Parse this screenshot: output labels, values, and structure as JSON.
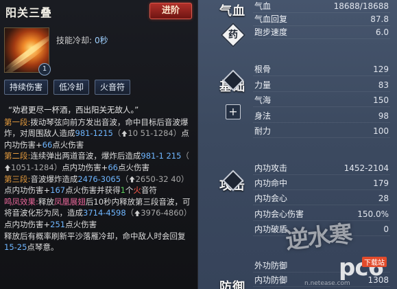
{
  "skill": {
    "title": "阳关三叠",
    "advance_label": "进阶",
    "level": "1",
    "cooldown_label": "技能冷却:",
    "cooldown_value": "0秒",
    "tags": [
      "持续伤害",
      "低冷却",
      "火音符"
    ],
    "quote": "“劝君更尽一杯酒，西出阳关无故人。”",
    "stage1": {
      "head": "第一段:",
      "text1": "拨动琴弦向前方发出音波，命中目标后音波爆炸，对周围敌人造成",
      "dmg": "981-1215",
      "up": "10 51-1284",
      "mid": "点内功伤害+",
      "fire": "66",
      "tail": "点火伤害"
    },
    "stage2": {
      "head": "第二段:",
      "text1": "连续弹出两道音波，爆炸后造成",
      "dmg": "981-1 215",
      "up": "1051-1284",
      "mid": "点内功伤害+",
      "fire": "66",
      "tail": "点火伤害"
    },
    "stage3": {
      "head": "第三段:",
      "text1": "音波爆炸造成",
      "dmg": "2476-3065",
      "up": "2650-32 40",
      "mid": "点内功伤害+",
      "fire": "167",
      "tail": "点火伤害并获得",
      "count": "1",
      "note": "个",
      "fire_note": "火",
      "tail2": "音符"
    },
    "effect": {
      "head": "鸣凤效果:",
      "text1": "释放",
      "skill_name": "凤凰展翅",
      "text2": "后10秒内释放第三段音波，可将音波化形为凤，造成",
      "dmg": "3714-4598",
      "up": "3976-4860",
      "mid": "点内功伤害+",
      "fire": "251",
      "tail": "点火伤害",
      "text3": "释放后有概率刷新平沙落雁冷却，命中敌人时会回复",
      "recover": "15-25",
      "tail2": "点琴意。"
    }
  },
  "stats": {
    "sections": [
      {
        "name": "气血"
      },
      {
        "name": "基础"
      },
      {
        "name": "攻击"
      },
      {
        "name": "防御"
      }
    ],
    "medicine_icon_label": "药",
    "plus_label": "+",
    "rows": [
      {
        "label": "气血",
        "value": "18688/18688"
      },
      {
        "label": "气血回复",
        "value": "87.8"
      },
      {
        "label": "跑步速度",
        "value": "6.0"
      },
      {
        "label": "根骨",
        "value": "129"
      },
      {
        "label": "力量",
        "value": "83"
      },
      {
        "label": "气海",
        "value": "150"
      },
      {
        "label": "身法",
        "value": "98"
      },
      {
        "label": "耐力",
        "value": "100"
      },
      {
        "label": "内功攻击",
        "value": "1452-2104"
      },
      {
        "label": "内功命中",
        "value": "179"
      },
      {
        "label": "内功会心",
        "value": "28"
      },
      {
        "label": "内功会心伤害",
        "value": "150.0%"
      },
      {
        "label": "内功破盾",
        "value": "0"
      },
      {
        "label": "外功防御",
        "value": ""
      },
      {
        "label": "内功防御",
        "value": "1308"
      }
    ]
  },
  "watermark": {
    "script": "逆水寒",
    "brand": "pc6",
    "dl": "下载站",
    "url": "n.netease.com"
  }
}
